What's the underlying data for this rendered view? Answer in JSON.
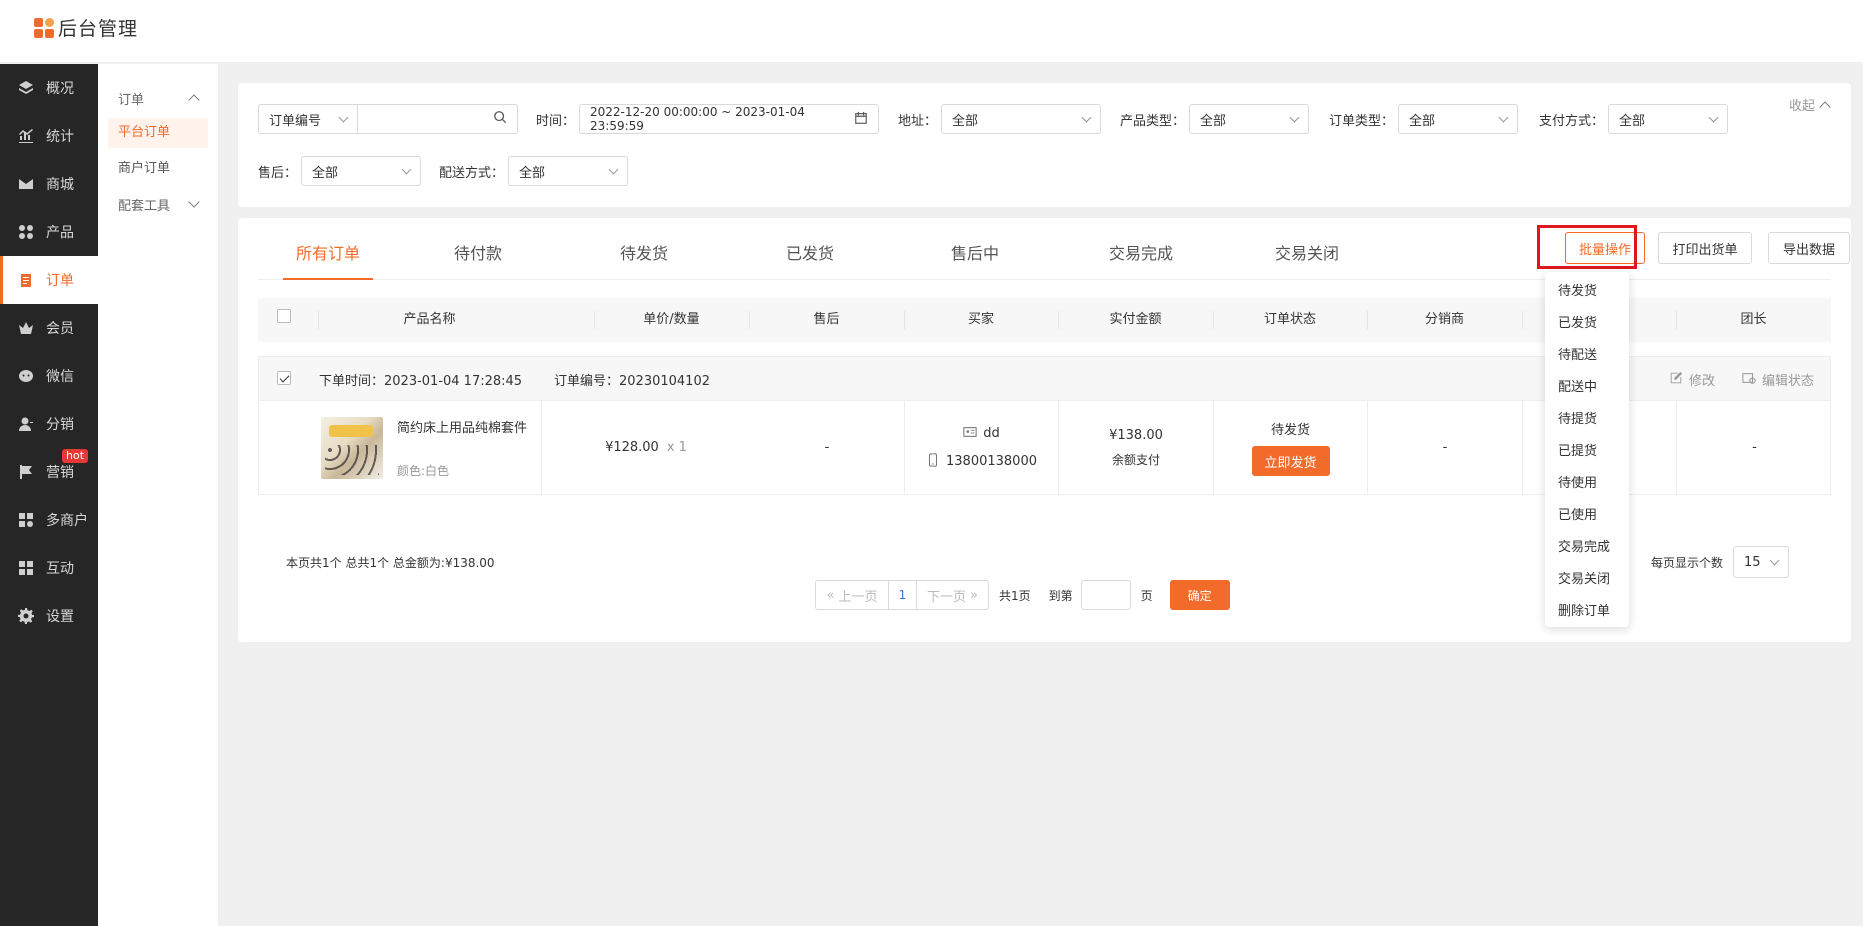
{
  "app": {
    "title": "后台管理"
  },
  "sidebar": {
    "items": [
      {
        "label": "概况",
        "icon": "layers-icon"
      },
      {
        "label": "统计",
        "icon": "chart-icon"
      },
      {
        "label": "商城",
        "icon": "mail-icon"
      },
      {
        "label": "产品",
        "icon": "grid-icon"
      },
      {
        "label": "订单",
        "icon": "clipboard-icon"
      },
      {
        "label": "会员",
        "icon": "crown-icon"
      },
      {
        "label": "微信",
        "icon": "wechat-icon"
      },
      {
        "label": "分销",
        "icon": "user-icon"
      },
      {
        "label": "营销",
        "icon": "flag-icon",
        "badge": "hot"
      },
      {
        "label": "多商户",
        "icon": "store-icon"
      },
      {
        "label": "互动",
        "icon": "apps-icon"
      },
      {
        "label": "设置",
        "icon": "gear-icon"
      }
    ]
  },
  "submenu": {
    "group": "订单",
    "items": [
      "平台订单",
      "商户订单"
    ],
    "tools": "配套工具"
  },
  "filters": {
    "search_field": "订单编号",
    "search_placeholder": "",
    "time_label": "时间：",
    "time_range": "2022-12-20 00:00:00 ~ 2023-01-04 23:59:59",
    "address_label": "地址：",
    "address_value": "全部",
    "product_type_label": "产品类型：",
    "product_type_value": "全部",
    "order_type_label": "订单类型：",
    "order_type_value": "全部",
    "payment_label": "支付方式：",
    "payment_value": "全部",
    "after_sale_label": "售后：",
    "after_sale_value": "全部",
    "delivery_label": "配送方式：",
    "delivery_value": "全部",
    "collapse_label": "收起"
  },
  "tabs": [
    "所有订单",
    "待付款",
    "待发货",
    "已发货",
    "售后中",
    "交易完成",
    "交易关闭"
  ],
  "actions": {
    "batch": "批量操作",
    "print": "打印出货单",
    "export": "导出数据"
  },
  "table": {
    "columns": [
      "产品名称",
      "单价/数量",
      "售后",
      "买家",
      "实付金额",
      "订单状态",
      "分销商",
      "团长"
    ]
  },
  "order": {
    "time_label": "下单时间：2023-01-04 17:28:45",
    "number_label": "订单编号：20230104102",
    "edit_label": "修改",
    "edit_status_label": "编辑状态",
    "product_name": "简约床上用品纯棉套件",
    "product_spec": "颜色:白色",
    "price": "¥128.00",
    "qty": "x 1",
    "after_sale": "-",
    "buyer_name": "dd",
    "buyer_phone": "13800138000",
    "paid": "¥138.00",
    "pay_method": "余额支付",
    "status": "待发货",
    "ship_button": "立即发货",
    "distributor": "-",
    "leader": "-"
  },
  "summary": "本页共1个   总共1个   总金额为:¥138.00",
  "pagination": {
    "prev": "上一页",
    "current": "1",
    "next": "下一页",
    "total_pages": "共1页",
    "goto_label": "到第",
    "page_unit": "页",
    "confirm": "确定",
    "per_page_label": "每页显示个数",
    "per_page_value": "15"
  },
  "dropdown": {
    "items": [
      "待发货",
      "已发货",
      "待配送",
      "配送中",
      "待提货",
      "已提货",
      "待使用",
      "已使用",
      "交易完成",
      "交易关闭",
      "删除订单"
    ]
  },
  "colors": {
    "accent": "#f36b2a",
    "sidebar_bg": "#262626",
    "highlight": "#e0161f"
  }
}
